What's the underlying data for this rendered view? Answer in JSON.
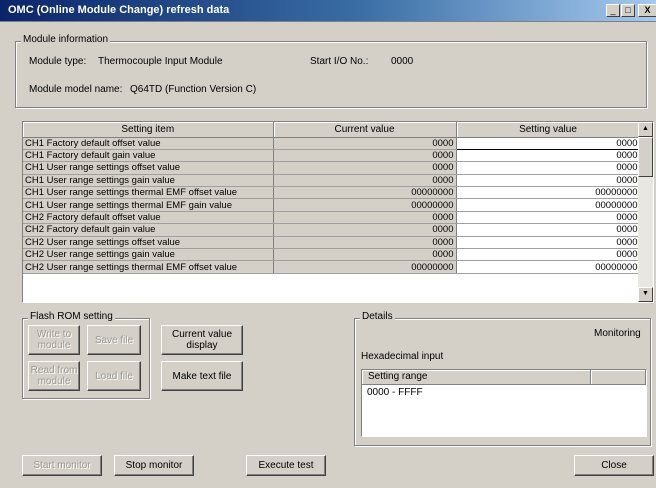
{
  "window": {
    "title": "OMC (Online Module Change) refresh data",
    "minimize_glyph": "_",
    "restore_glyph": "□",
    "close_glyph": "X"
  },
  "module_info": {
    "legend": "Module information",
    "type_label": "Module type:",
    "type_value": "Thermocouple Input Module",
    "start_io_label": "Start I/O No.:",
    "start_io_value": "0000",
    "model_label": "Module model name:",
    "model_value": "Q64TD (Function Version C)"
  },
  "grid": {
    "headers": [
      "Setting item",
      "Current value",
      "Setting value"
    ],
    "rows": [
      {
        "item": "CH1 Factory default offset value",
        "current": "0000",
        "setting": "0000"
      },
      {
        "item": "CH1 Factory default gain value",
        "current": "0000",
        "setting": "0000"
      },
      {
        "item": "CH1 User range settings offset value",
        "current": "0000",
        "setting": "0000"
      },
      {
        "item": "CH1 User range settings gain value",
        "current": "0000",
        "setting": "0000"
      },
      {
        "item": "CH1 User range settings thermal EMF offset value",
        "current": "00000000",
        "setting": "00000000"
      },
      {
        "item": "CH1 User range settings thermal EMF gain value",
        "current": "00000000",
        "setting": "00000000"
      },
      {
        "item": "CH2 Factory default offset value",
        "current": "0000",
        "setting": "0000"
      },
      {
        "item": "CH2 Factory default gain value",
        "current": "0000",
        "setting": "0000"
      },
      {
        "item": "CH2 User range settings offset value",
        "current": "0000",
        "setting": "0000"
      },
      {
        "item": "CH2 User range settings gain value",
        "current": "0000",
        "setting": "0000"
      },
      {
        "item": "CH2 User range settings thermal EMF offset value",
        "current": "00000000",
        "setting": "00000000"
      }
    ],
    "scroll_up_glyph": "▲",
    "scroll_down_glyph": "▼"
  },
  "flash_rom": {
    "legend": "Flash ROM setting",
    "write_to_module": "Write to module",
    "save_file": "Save file",
    "read_from_module": "Read from module",
    "load_file": "Load file"
  },
  "actions": {
    "current_value_display": "Current value display",
    "make_text_file": "Make text file"
  },
  "details": {
    "legend": "Details",
    "status": "Monitoring",
    "input_mode": "Hexadecimal input",
    "range_header": "Setting range",
    "range_value": "0000 - FFFF"
  },
  "footer": {
    "start_monitor": "Start monitor",
    "stop_monitor": "Stop monitor",
    "execute_test": "Execute test",
    "close": "Close"
  }
}
